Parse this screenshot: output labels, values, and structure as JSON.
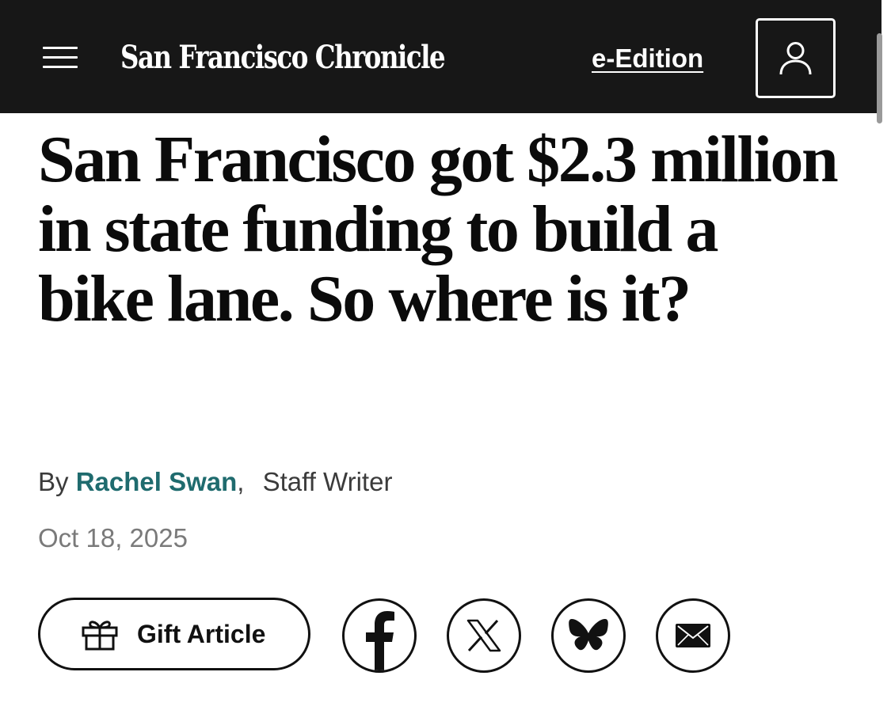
{
  "header": {
    "menu_icon": "hamburger-menu-icon",
    "logo_text": "San Francisco Chronicle",
    "e_edition_label": "e-Edition",
    "account_icon": "user-account-icon"
  },
  "article": {
    "headline": "San Francisco got $2.3 million in state funding to build a bike lane. So where is it?",
    "byline": {
      "prefix": "By",
      "author": "Rachel Swan",
      "separator": ",",
      "role": "Staff Writer"
    },
    "date": "Oct 18, 2025"
  },
  "share": {
    "gift_label": "Gift Article",
    "gift_icon": "gift-icon",
    "buttons": [
      {
        "name": "facebook",
        "icon": "facebook-icon"
      },
      {
        "name": "x",
        "icon": "x-icon"
      },
      {
        "name": "bluesky",
        "icon": "bluesky-butterfly-icon"
      },
      {
        "name": "email",
        "icon": "envelope-icon"
      }
    ]
  },
  "colors": {
    "header_bg": "#171717",
    "author_link": "#1f6b6e",
    "date_text": "#7a7a7a",
    "body_text": "#0b0b0b"
  }
}
